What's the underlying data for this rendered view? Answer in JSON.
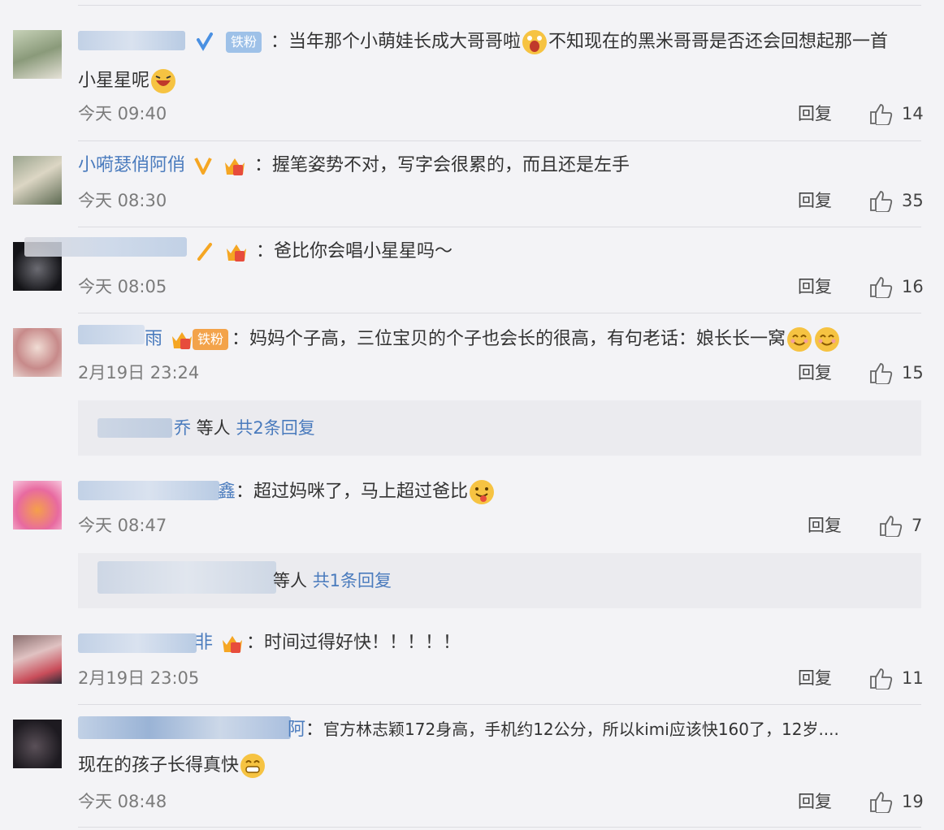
{
  "ui": {
    "reply_label": "回复",
    "colon": "："
  },
  "comments": [
    {
      "name": "",
      "badge": "铁粉",
      "verified": "blue",
      "text": "当年那个小萌娃长成大哥哥啦",
      "text2": "不知现在的黑米哥哥是否还会回想起那一首",
      "text3": "小星星呢",
      "time": "今天 09:40",
      "likes": "14"
    },
    {
      "name": "小嗬瑟俏阿俏",
      "verified": "gold",
      "text": "握笔姿势不对，写字会很累的，而且还是左手",
      "time": "今天 08:30",
      "likes": "35"
    },
    {
      "name": "",
      "text": "爸比你会唱小星星吗～",
      "time": "今天 08:05",
      "likes": "16"
    },
    {
      "name": "雨",
      "badge": "铁粉",
      "text": "妈妈个子高，三位宝贝的个子也会长的很高，有句老话：娘长长一窝",
      "time": "2月19日 23:24",
      "likes": "15",
      "sub": {
        "who": "乔",
        "etc": " 等人 ",
        "total": "共2条回复"
      }
    },
    {
      "name": "鑫",
      "text": "超过妈咪了，马上超过爸比",
      "time": "今天 08:47",
      "likes": "7",
      "sub": {
        "who": "",
        "etc": "等人 ",
        "total": "共1条回复"
      }
    },
    {
      "name": "非",
      "text": "时间过得好快！！！！！",
      "time": "2月19日 23:05",
      "likes": "11"
    },
    {
      "name": "阿",
      "text": "官方林志颖172身高，手机约12公分，所以kimi应该快160了，12岁....",
      "text2": "现在的孩子长得真快",
      "time": "今天 08:48",
      "likes": "19"
    }
  ],
  "icons": {
    "like": "thumbs-up-icon",
    "crown": "crown-level-icon",
    "verified": "verified-v-icon"
  },
  "colors": {
    "link": "#4a7bbd",
    "badge_blue": "#9ec1e8",
    "background": "#f3f3f6"
  }
}
